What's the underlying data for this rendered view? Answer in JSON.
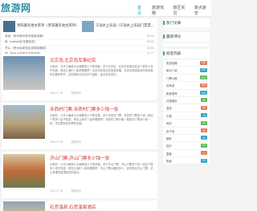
{
  "header": {
    "logo": "旅游网",
    "nav": [
      "首页",
      "旅游攻略",
      "景区实况",
      "景点速览"
    ]
  },
  "top": {
    "features": [
      {
        "text": "贵阳著名地水库评（贵阳著名地水库评）"
      },
      {
        "text": "宁海水上乐园（宁海水上乐园门票票..."
      }
    ],
    "news": [
      {
        "text": "游游（贵州贵州贵州旅游攻略）",
        "date": "02-01"
      },
      {
        "text": "秋（cabinet红花景游览）",
        "date": "02-01"
      },
      {
        "text": "节从（贵州水库知名自驾游路线）",
        "date": "02-01"
      },
      {
        "text": "团（贵州水库知名自驾游线）",
        "date": "02-01"
      },
      {
        "text": "游团（峨眉山旅游攻略app）",
        "date": "02-01"
      }
    ]
  },
  "articles": [
    {
      "title": "北京岛,北京岛军事纪实",
      "summary": "大家好，今天小编来为大家解答以下的问题，关于北京岛，北京岛军事纪实这个很多人还不知道，现在让我们一起来看看吧！北京岛军事纪实旅游攻略，北京岛旅游最佳时间是每年的春秋季节，这时候的北京岛天气温和，适合游览观光。",
      "date": "2024-07-02",
      "views": "旅游资讯"
    },
    {
      "title": "寺西村门票,寺西村门票多少钱一张",
      "summary": "大家好，今天小编来为大家解答以下的问题，关于寺西村门票，寺西村门票多少钱一张这个很多人还不知道，现在让我们一起来看看吧！寺西村门票价格一般是成人票多少钱一张，学生票和老年票有优惠。",
      "date": "2024-07-02",
      "views": "旅游资讯"
    },
    {
      "title": "济山门票,济山门票多少钱一张",
      "summary": "大家好，今天小编来为大家解答以下的问题，关于济山门票，济山门票多少钱一张这个很多人还不知道，现在让我们一起来看看吧！济山门票价格是多少，如何购买济山门票，济山有哪些值得游览的景点。",
      "date": "2024-07-02",
      "views": "旅游资讯"
    },
    {
      "title": "石宫温泉,石宫温泉酒店",
      "summary": "",
      "date": "",
      "views": ""
    }
  ],
  "sidebar": {
    "recommend_title": "热门文章",
    "hot_title": "最新评论",
    "tags_title": "标签列表",
    "tags": [
      {
        "label": "旅游攻略",
        "count": "168",
        "color": "#e07a5f"
      },
      {
        "label": "景点介绍",
        "count": "152",
        "color": "#3aa3c4"
      },
      {
        "label": "门票价格",
        "count": "140",
        "color": "#5cb85c"
      },
      {
        "label": "自驾游",
        "count": "126",
        "color": "#e07a5f"
      },
      {
        "label": "美食推荐",
        "count": "118",
        "color": "#3aa3c4"
      },
      {
        "label": "住宿酒店",
        "count": "96",
        "color": "#5cb85c"
      },
      {
        "label": "温泉",
        "count": "88",
        "color": "#e07a5f"
      },
      {
        "label": "古镇",
        "count": "74",
        "color": "#3aa3c4"
      },
      {
        "label": "海岛",
        "count": "63",
        "color": "#5cb85c"
      },
      {
        "label": "亲子游",
        "count": "52",
        "color": "#e07a5f"
      },
      {
        "label": "摄影",
        "count": "41",
        "color": "#3aa3c4"
      },
      {
        "label": "徒步",
        "count": "33",
        "color": "#5cb85c"
      },
      {
        "label": "露营",
        "count": "27",
        "color": "#e07a5f"
      },
      {
        "label": "夜景",
        "count": "19",
        "color": "#3aa3c4"
      }
    ]
  }
}
